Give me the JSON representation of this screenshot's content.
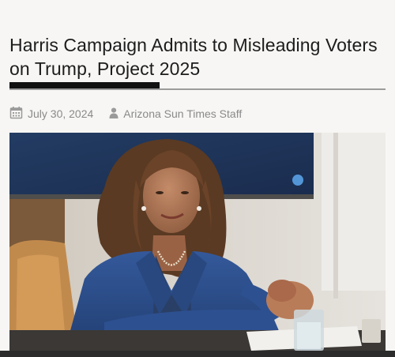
{
  "article": {
    "headline": "Harris Campaign Admits to Misleading Voters on Trump, Project 2025",
    "date": "July 30, 2024",
    "author": "Arizona Sun Times Staff",
    "date_icon": "calendar-icon",
    "author_icon": "person-icon"
  },
  "photo": {
    "subject": "woman in blue blazer seated at table with clasped hands"
  },
  "colors": {
    "headline": "#1c1c1c",
    "meta": "#8a8a8a",
    "accent_rule": "#111111",
    "blazer": "#2b4d8c"
  }
}
